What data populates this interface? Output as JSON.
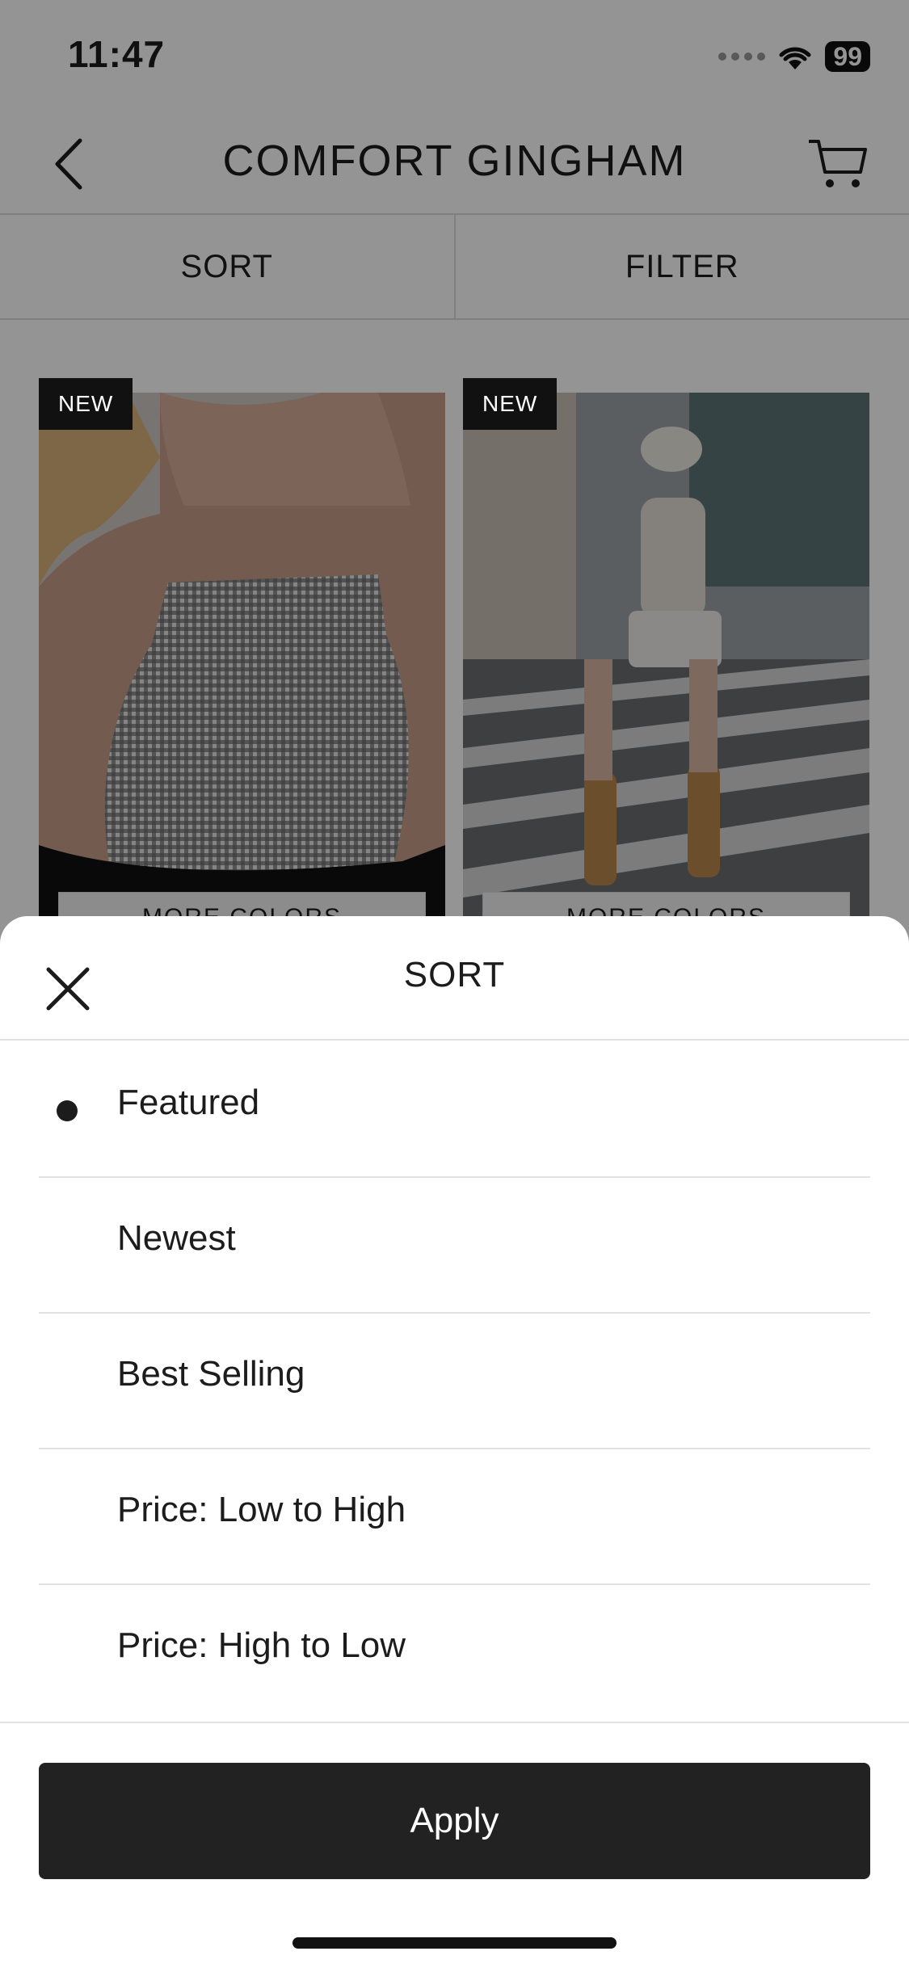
{
  "status_bar": {
    "time": "11:47",
    "battery": "99"
  },
  "nav": {
    "title": "COMFORT GINGHAM"
  },
  "tabs": [
    {
      "label": "SORT"
    },
    {
      "label": "FILTER"
    }
  ],
  "products": [
    {
      "badge": "NEW",
      "more_colors": "MORE COLORS"
    },
    {
      "badge": "NEW",
      "more_colors": "MORE COLORS"
    }
  ],
  "sort_sheet": {
    "title": "SORT",
    "options": [
      {
        "label": "Featured",
        "selected": true
      },
      {
        "label": "Newest",
        "selected": false
      },
      {
        "label": "Best Selling",
        "selected": false
      },
      {
        "label": "Price: Low to High",
        "selected": false
      },
      {
        "label": "Price: High to Low",
        "selected": false
      }
    ],
    "apply_label": "Apply"
  },
  "colors": {
    "accent": "#222222",
    "overlay": "rgba(0,0,0,0.42)",
    "badge": "#111111"
  },
  "icons": [
    "back-chevron-icon",
    "cart-icon",
    "close-icon",
    "wifi-icon"
  ]
}
